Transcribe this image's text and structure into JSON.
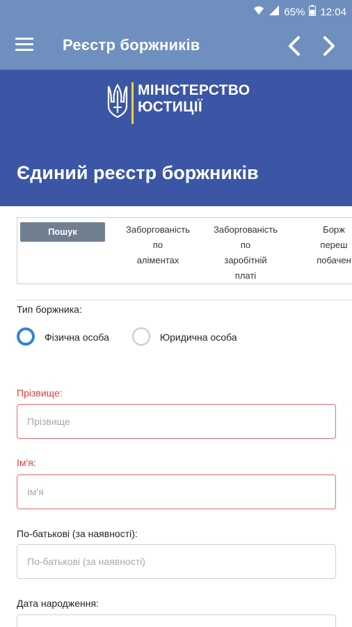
{
  "status_bar": {
    "battery": "65%",
    "time": "12:04"
  },
  "toolbar": {
    "title": "Реєстр боржників"
  },
  "ministry": {
    "logo_line1": "МІНІСТЕРСТВО",
    "logo_line2": "ЮСТИЦІЇ",
    "page_title": "Єдиний реєстр боржників"
  },
  "tabs": [
    {
      "label": "Пошук",
      "active": true
    },
    {
      "label": "Заборгованість\nпо\nаліментах",
      "active": false
    },
    {
      "label": "Заборгованість\nпо\nзаробітній\nплаті",
      "active": false
    },
    {
      "label": "Борж\nпереш\nпобачен",
      "active": false
    }
  ],
  "form": {
    "debtor_type_label": "Тип боржника:",
    "radio_individual": "Фізична особа",
    "radio_legal": "Юридична особа",
    "selected_type": "Фізична особа",
    "surname_label": "Прізвище:",
    "surname_placeholder": "Прізвище",
    "name_label": "Ім'я:",
    "name_placeholder": "Ім'я",
    "patronymic_label": "По-батькові (за наявності):",
    "patronymic_placeholder": "По-батькові (за наявності)",
    "birthdate_label": "Дата народження:"
  },
  "colors": {
    "toolbar": "#6f8fbf",
    "ministry_header": "#3c56a6",
    "flag_yellow": "#f3d23a",
    "error_red": "#e03b3b",
    "radio_blue": "#2d86d6"
  }
}
